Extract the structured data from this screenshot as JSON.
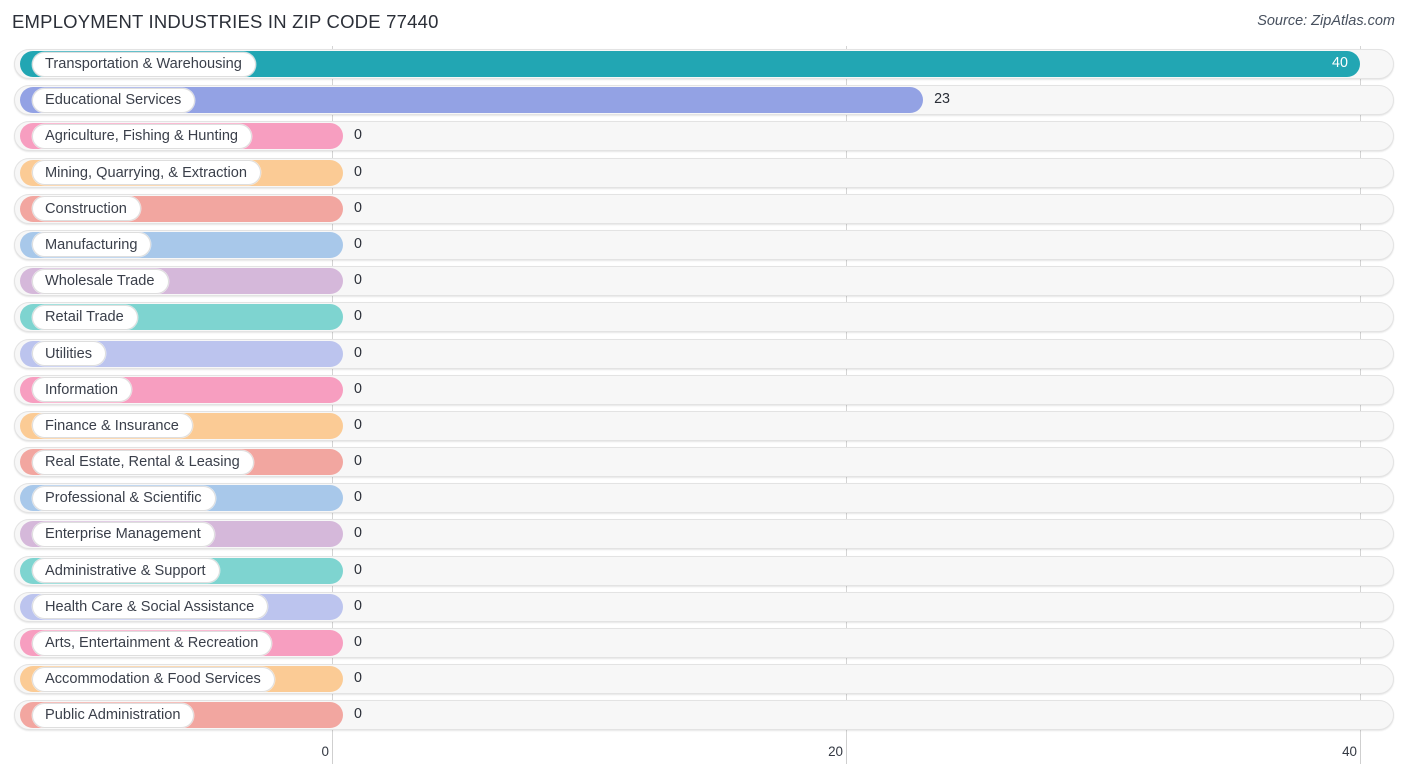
{
  "header": {
    "title": "EMPLOYMENT INDUSTRIES IN ZIP CODE 77440",
    "source": "Source: ZipAtlas.com"
  },
  "chart_data": {
    "type": "bar",
    "orientation": "horizontal",
    "title": "EMPLOYMENT INDUSTRIES IN ZIP CODE 77440",
    "xlabel": "",
    "ylabel": "",
    "xlim": [
      0,
      40
    ],
    "ticks": [
      "0",
      "20",
      "40"
    ],
    "tick_values": [
      0,
      20,
      40
    ],
    "grid": true,
    "legend": false,
    "categories": [
      "Transportation & Warehousing",
      "Educational Services",
      "Agriculture, Fishing & Hunting",
      "Mining, Quarrying, & Extraction",
      "Construction",
      "Manufacturing",
      "Wholesale Trade",
      "Retail Trade",
      "Utilities",
      "Information",
      "Finance & Insurance",
      "Real Estate, Rental & Leasing",
      "Professional & Scientific",
      "Enterprise Management",
      "Administrative & Support",
      "Health Care & Social Assistance",
      "Arts, Entertainment & Recreation",
      "Accommodation & Food Services",
      "Public Administration"
    ],
    "values": [
      40,
      23,
      0,
      0,
      0,
      0,
      0,
      0,
      0,
      0,
      0,
      0,
      0,
      0,
      0,
      0,
      0,
      0,
      0
    ],
    "value_labels": [
      "40",
      "23",
      "0",
      "0",
      "0",
      "0",
      "0",
      "0",
      "0",
      "0",
      "0",
      "0",
      "0",
      "0",
      "0",
      "0",
      "0",
      "0",
      "0"
    ],
    "colors": [
      "#22a6b3",
      "#93a2e4",
      "#f79ec0",
      "#fbcb95",
      "#f2a6a0",
      "#a8c8ea",
      "#d5b8da",
      "#7ed4d0",
      "#bcc4ee",
      "#f79ec0",
      "#fbcb95",
      "#f2a6a0",
      "#a8c8ea",
      "#d5b8da",
      "#7ed4d0",
      "#bcc4ee",
      "#f79ec0",
      "#fbcb95",
      "#f2a6a0"
    ]
  }
}
